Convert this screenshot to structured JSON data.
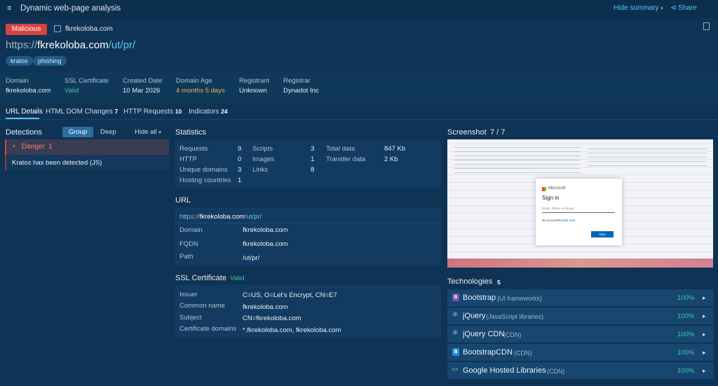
{
  "header": {
    "title": "Dynamic web-page analysis",
    "hide_summary": "Hide summary",
    "share": "Share"
  },
  "summary": {
    "verdict": "Malicious",
    "host": "fkrekoloba.com",
    "url_prefix": "https://",
    "url_domain": "fkrekoloba.com",
    "url_path": "/ut/pr/",
    "tags": [
      "kratos",
      "phishing"
    ],
    "colors": {
      "malicious": "#d64242",
      "accent": "#5cc4f2",
      "valid": "#3fc8a2",
      "warn": "#f0b648"
    }
  },
  "info": [
    {
      "label": "Domain",
      "value": "fkrekoloba.com"
    },
    {
      "label": "SSL Certificate",
      "value": "Valid"
    },
    {
      "label": "Created Date",
      "value": "10 Mar 2026"
    },
    {
      "label": "Domain Age",
      "value": "4 months 5 days"
    },
    {
      "label": "Registrant",
      "value": "Unknown"
    },
    {
      "label": "Registrar",
      "value": "Dynadot Inc"
    }
  ],
  "tabs": [
    {
      "label": "URL Details",
      "count": ""
    },
    {
      "label": "HTML DOM Changes",
      "count": "7"
    },
    {
      "label": "HTTP Requests",
      "count": "10"
    },
    {
      "label": "Indicators",
      "count": "24"
    }
  ],
  "detections": {
    "title": "Detections",
    "group": "Group",
    "deep": "Deep",
    "hide_all": "Hide all",
    "danger_label": "Danger",
    "danger_count": "1",
    "item": "Kratos has been detected (JS)"
  },
  "statistics": {
    "title": "Statistics",
    "col1": [
      {
        "label": "Requests",
        "value": "9"
      },
      {
        "label": "HTTP",
        "value": "0"
      },
      {
        "label": "Unique domains",
        "value": "3"
      },
      {
        "label": "Hosting countries",
        "value": "1"
      }
    ],
    "col2": [
      {
        "label": "Scripts",
        "value": "3"
      },
      {
        "label": "Images",
        "value": "1"
      },
      {
        "label": "Links",
        "value": "8"
      }
    ],
    "col3": [
      {
        "label": "Total data",
        "value": "847 Kb"
      },
      {
        "label": "Transfer data",
        "value": "2 Kb"
      }
    ]
  },
  "url_section": {
    "title": "URL",
    "full_prefix": "https://",
    "full_domain": "fkrekoloba.com",
    "full_path": "/ut/pr/",
    "rows": [
      {
        "label": "Domain",
        "value": "fkrekoloba.com"
      },
      {
        "label": "FQDN",
        "value": "fkrekoloba.com"
      },
      {
        "label": "Path",
        "value": "/ut/pr/"
      }
    ]
  },
  "ssl": {
    "title": "SSL Certificate",
    "status": "Valid",
    "rows": [
      {
        "label": "Issuer",
        "value": "C=US, O=Let's Encrypt, CN=E7"
      },
      {
        "label": "Common name",
        "value": "fkrekoloba.com"
      },
      {
        "label": "Subject",
        "value": "CN=fkrekoloba.com"
      },
      {
        "label": "Certificate domains",
        "value": "*.fkrekoloba.com, fkrekoloba.com"
      }
    ]
  },
  "screenshot": {
    "title": "Screenshot",
    "counter": "7 / 7",
    "brand": "Microsoft",
    "heading": "Sign in",
    "placeholder": "Email, Phone or Skype",
    "no_account": "No account?",
    "create": "Create one!",
    "next": "Next"
  },
  "technologies": {
    "title": "Technologies",
    "count": "5",
    "items": [
      {
        "name": "Bootstrap",
        "category": "(UI frameworks)",
        "pct": "100%",
        "icon": "bootstrap-icon"
      },
      {
        "name": "jQuery",
        "category": "(JavaScript libraries)",
        "pct": "100%",
        "icon": "jquery-icon"
      },
      {
        "name": "jQuery CDN",
        "category": "(CDN)",
        "pct": "100%",
        "icon": "jquery-icon"
      },
      {
        "name": "BootstrapCDN",
        "category": "(CDN)",
        "pct": "100%",
        "icon": "bootstrapcdn-icon"
      },
      {
        "name": "Google Hosted Libraries",
        "category": "(CDN)",
        "pct": "100%",
        "icon": "google-code-icon"
      }
    ]
  }
}
